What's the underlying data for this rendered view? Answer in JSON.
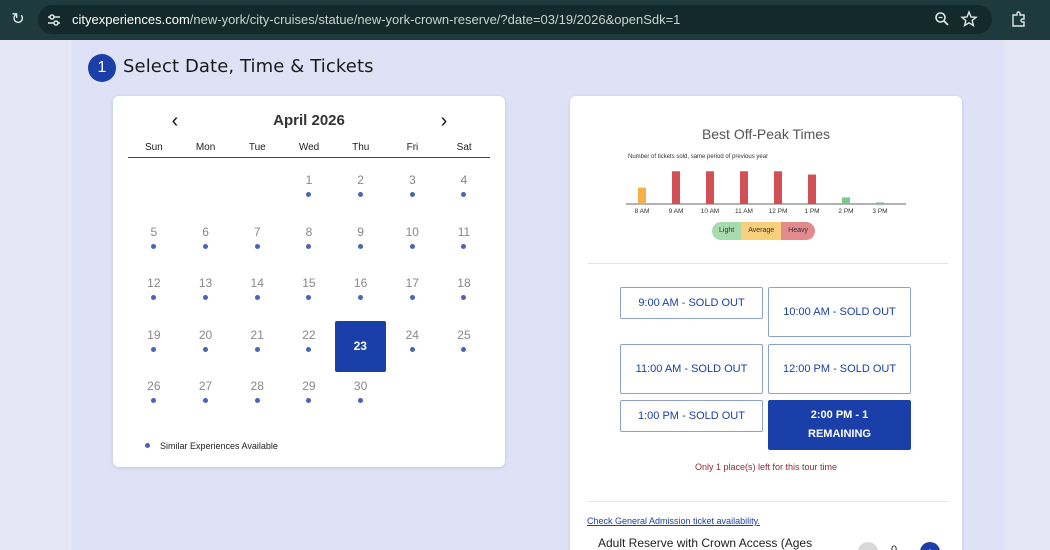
{
  "browser": {
    "url_host": "cityexperiences.com",
    "url_path": "/new-york/city-cruises/statue/new-york-crown-reserve/?date=03/19/2026&openSdk=1"
  },
  "step": {
    "number": "1",
    "title": "Select Date, Time & Tickets"
  },
  "calendar": {
    "month_label": "April 2026",
    "weekdays": [
      "Sun",
      "Mon",
      "Tue",
      "Wed",
      "Thu",
      "Fri",
      "Sat"
    ],
    "selected_day": "23",
    "legend": "Similar Experiences Available"
  },
  "chart_data": {
    "type": "bar",
    "title": "Best Off-Peak Times",
    "subtitle": "Number of tickets sold, same period of previous year",
    "categories": [
      "8 AM",
      "9 AM",
      "10 AM",
      "11 AM",
      "12 PM",
      "1 PM",
      "2 PM",
      "3 PM"
    ],
    "values": [
      5,
      10,
      10,
      10,
      10,
      9,
      2,
      0.5
    ],
    "levels": [
      "average",
      "heavy",
      "heavy",
      "heavy",
      "heavy",
      "heavy",
      "light",
      "light"
    ],
    "ylim": [
      0,
      11
    ],
    "legend": [
      "Light",
      "Average",
      "Heavy"
    ],
    "colors": {
      "light": "#7ec98a",
      "average": "#f5b04a",
      "heavy": "#d24f55"
    }
  },
  "legend_colors": {
    "light": "#a6dcae",
    "average": "#f8cf7a",
    "heavy": "#e28a8e"
  },
  "time_slots": [
    {
      "label": "9:00 AM - SOLD OUT"
    },
    {
      "label": "10:00 AM - SOLD OUT"
    },
    {
      "label": "11:00 AM - SOLD OUT"
    },
    {
      "label": "12:00 PM - SOLD OUT"
    },
    {
      "label": "1:00 PM - SOLD OUT"
    },
    {
      "label": "2:00 PM - 1 REMAINING"
    }
  ],
  "remaining_note": "Only 1 place(s) left for this tour time",
  "general_admission_link": "Check General Admission ticket availability.",
  "ticket": {
    "name": "Adult Reserve with Crown Access (Ages",
    "quantity": "0",
    "plus": "+"
  }
}
